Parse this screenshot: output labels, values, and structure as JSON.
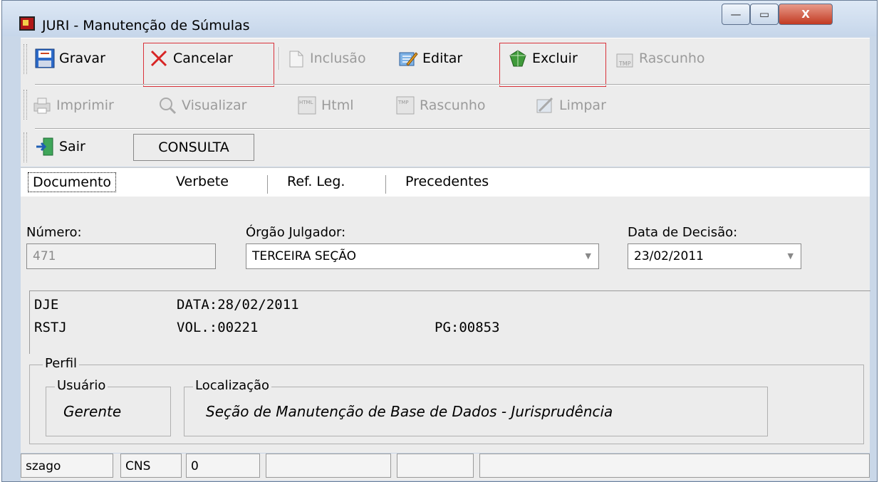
{
  "window": {
    "title": "JURI - Manutenção de Súmulas",
    "minimize_glyph": "—",
    "maximize_glyph": "▭",
    "close_glyph": "X"
  },
  "toolbar1": {
    "gravar": "Gravar",
    "cancelar": "Cancelar",
    "inclusao": "Inclusão",
    "editar": "Editar",
    "excluir": "Excluir",
    "rascunho": "Rascunho"
  },
  "toolbar2": {
    "imprimir": "Imprimir",
    "visualizar": "Visualizar",
    "html": "Html",
    "rascunho": "Rascunho",
    "limpar": "Limpar"
  },
  "toolbar3": {
    "sair": "Sair",
    "mode": "CONSULTA"
  },
  "tabs": [
    "Documento",
    "Verbete",
    "Ref. Leg.",
    "Precedentes"
  ],
  "form": {
    "numero_label": "Número:",
    "numero_value": "471",
    "orgao_label": "Órgão Julgador:",
    "orgao_value": "TERCEIRA SEÇÃO",
    "data_label": "Data de Decisão:",
    "data_value": "23/02/2011"
  },
  "memo": {
    "r1c1": "DJE",
    "r1c2": "DATA:28/02/2011",
    "r2c1": "RSTJ",
    "r2c2": "VOL.:00221",
    "r2c3": "PG:00853"
  },
  "perfil": {
    "label": "Perfil",
    "usuario_label": "Usuário",
    "usuario_value": "Gerente",
    "local_label": "Localização",
    "local_value": "Seção de Manutenção de Base de Dados - Jurisprudência"
  },
  "status": {
    "user": "szago",
    "code": "CNS",
    "num": "0"
  },
  "colors": {
    "highlight": "#d9323a",
    "disabled_text": "#9b9b9b"
  }
}
